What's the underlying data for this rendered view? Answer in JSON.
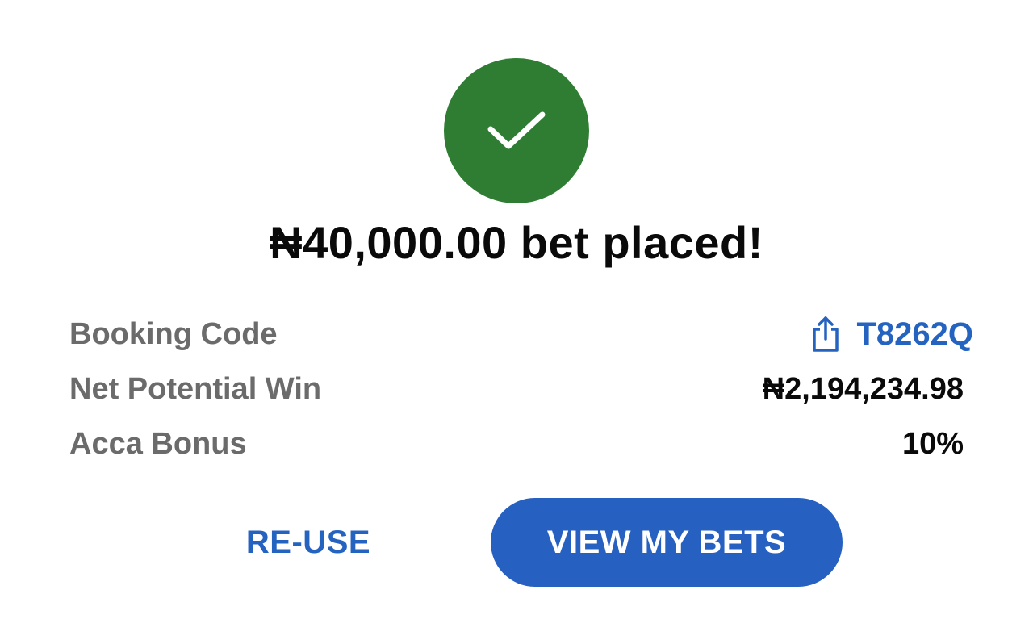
{
  "status": {
    "icon": "check-icon",
    "icon_bg_color": "#2e7d32",
    "headline": "₦40,000.00 bet placed!"
  },
  "details": [
    {
      "label": "Booking Code",
      "value": "T8262Q",
      "icon": "share-icon"
    },
    {
      "label": "Net Potential Win",
      "value": "₦2,194,234.98"
    },
    {
      "label": "Acca Bonus",
      "value": "10%"
    }
  ],
  "actions": {
    "reuse_label": "RE-USE",
    "view_bets_label": "VIEW MY BETS"
  },
  "colors": {
    "accent": "#2563c0",
    "button_bg": "#2660c0",
    "label_text": "#6b6b6b"
  }
}
